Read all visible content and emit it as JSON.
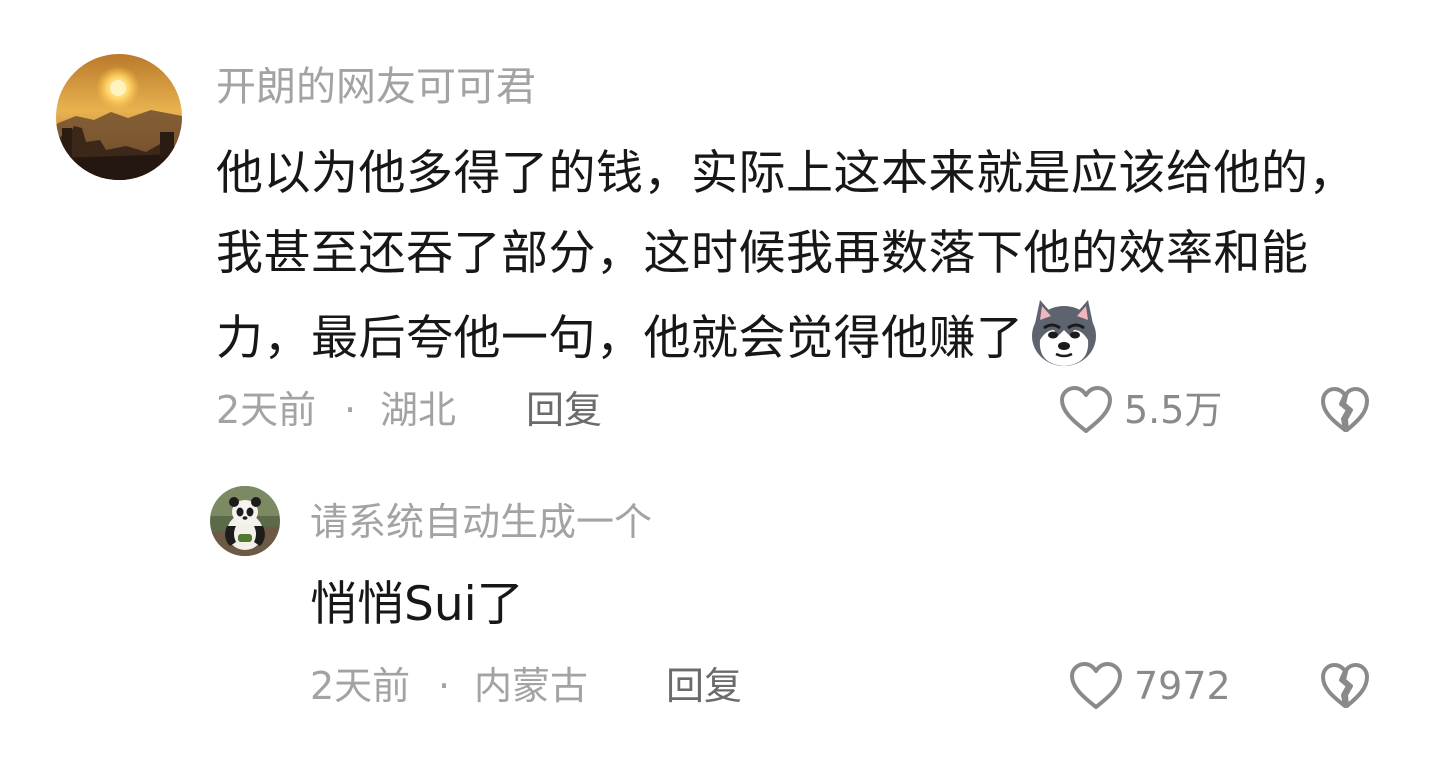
{
  "comments": [
    {
      "username": "开朗的网友可可君",
      "text": "他以为他多得了的钱，实际上这本来就是应该给他的，我甚至还吞了部分，这时候我再数落下他的效率和能力，最后夸他一句，他就会觉得他赚了",
      "emoji": "husky-dog-emoji",
      "time": "2天前",
      "location": "湖北",
      "reply_label": "回复",
      "likes": "5.5万",
      "avatar": "sunset-landscape-avatar"
    },
    {
      "username": "请系统自动生成一个",
      "text": "悄悄Sui了",
      "time": "2天前",
      "location": "内蒙古",
      "reply_label": "回复",
      "likes": "7972",
      "avatar": "panda-avatar"
    }
  ],
  "separator": "·",
  "colors": {
    "username": "#a3a3a3",
    "body": "#171717",
    "meta": "#a3a3a3",
    "reply": "#6b6b6b",
    "icon": "#8a8a8a"
  },
  "icons": {
    "like": "heart-outline-icon",
    "dislike": "broken-heart-icon"
  }
}
